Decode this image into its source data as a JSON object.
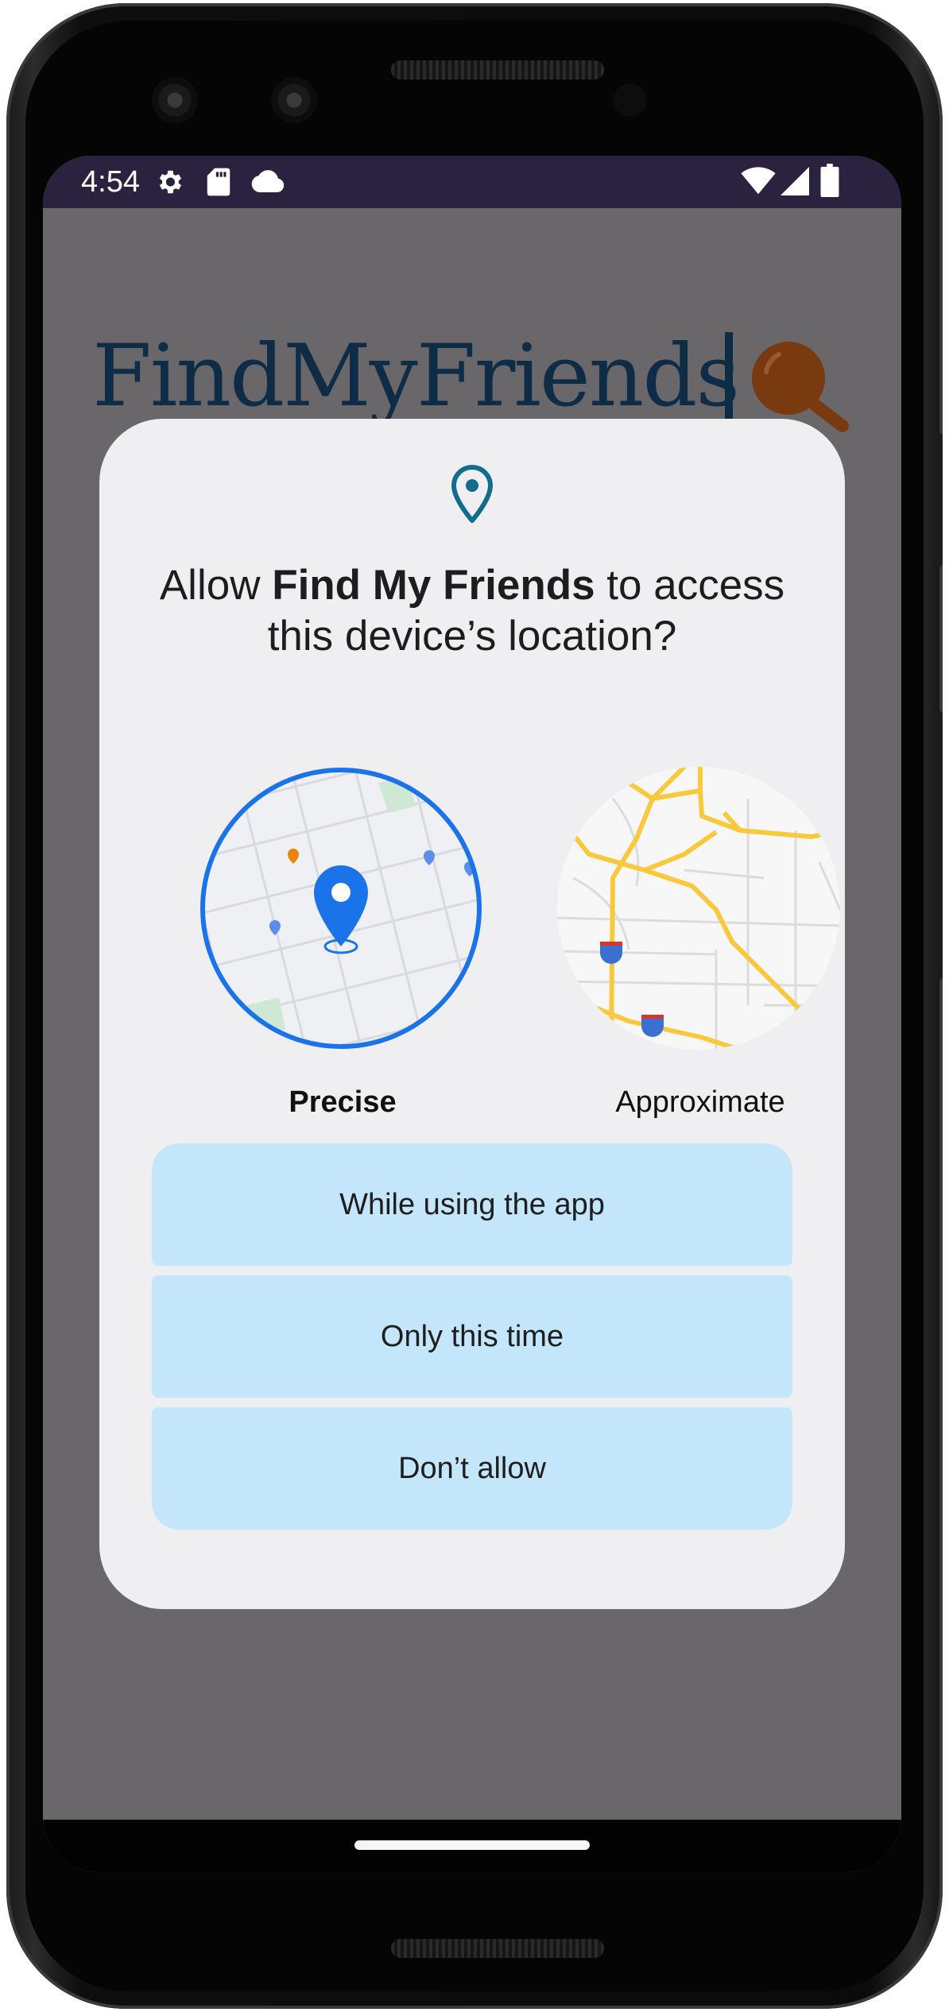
{
  "status_bar": {
    "time": "4:54",
    "left_icons": [
      "gear-icon",
      "sd-card-icon",
      "cloud-icon"
    ],
    "right_icons": [
      "wifi-icon",
      "cell-signal-icon",
      "battery-icon"
    ]
  },
  "app": {
    "logo_text": "FindMyFriends"
  },
  "dialog": {
    "title_prefix": "Allow ",
    "app_name": "Find My Friends",
    "title_suffix": " to access this device’s location?",
    "options": [
      {
        "label": "Precise",
        "selected": true
      },
      {
        "label": "Approximate",
        "selected": false
      }
    ],
    "buttons": {
      "while_using": "While using the app",
      "only_this_time": "Only this time",
      "dont_allow": "Don’t allow"
    }
  },
  "colors": {
    "accent_blue": "#1a73e8",
    "button_bg": "#c4e6fb",
    "status_bar": "#2b2240",
    "scrim": "#69676a",
    "dialog_bg": "#efeff2",
    "logo_navy": "#0f2c47",
    "logo_magnifier": "#7a3a10",
    "road_yellow": "#f8c93c"
  }
}
